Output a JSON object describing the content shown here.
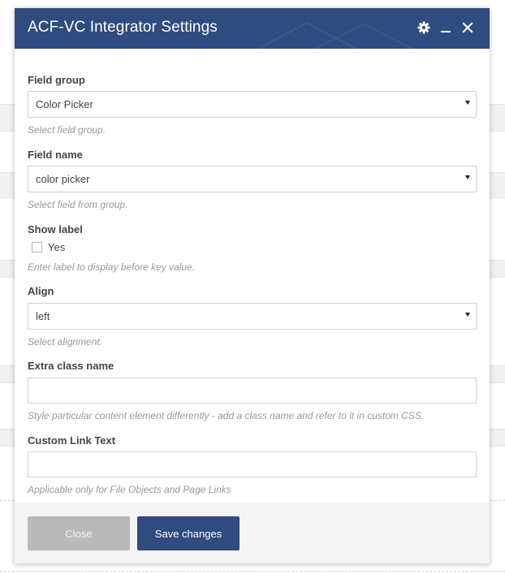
{
  "modal": {
    "title": "ACF-VC Integrator Settings",
    "header_color": "#2f4b80",
    "icons": {
      "settings": "gear-icon",
      "minimize": "minimize-icon",
      "close": "close-icon"
    }
  },
  "fields": {
    "field_group": {
      "label": "Field group",
      "value": "Color Picker",
      "help": "Select field group."
    },
    "field_name": {
      "label": "Field name",
      "value": "color picker",
      "help": "Select field from group."
    },
    "show_label": {
      "label": "Show label",
      "checkbox_label": "Yes",
      "checked": false,
      "help": "Enter label to display before key value."
    },
    "align": {
      "label": "Align",
      "value": "left",
      "help": "Select alignment."
    },
    "extra_class": {
      "label": "Extra class name",
      "value": "",
      "help": "Style particular content element differently - add a class name and refer to it in custom CSS."
    },
    "custom_link_text": {
      "label": "Custom Link Text",
      "value": "",
      "help": "Applicable only for File Objects and Page Links"
    }
  },
  "footer": {
    "close_label": "Close",
    "save_label": "Save changes"
  }
}
